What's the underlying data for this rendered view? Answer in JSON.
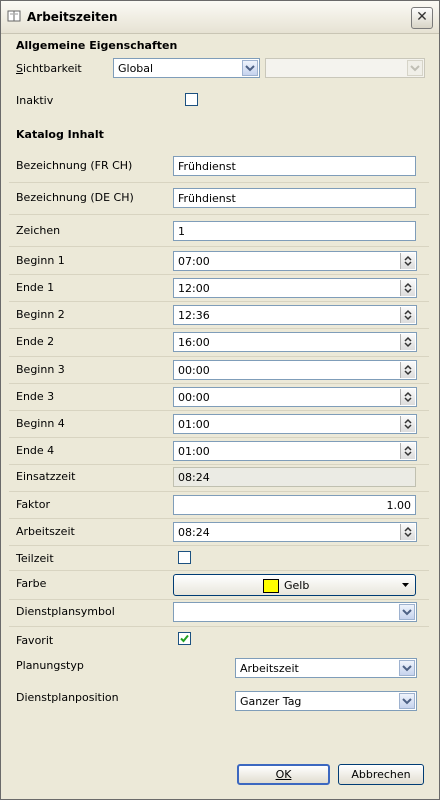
{
  "window": {
    "title": "Arbeitszeiten"
  },
  "general": {
    "heading": "Allgemeine Eigenschaften",
    "sichtbarkeit_label": "Sichtbarkeit",
    "sichtbarkeit_value": "Global",
    "inaktiv_label": "Inaktiv",
    "inaktiv_checked": false
  },
  "catalog": {
    "heading": "Katalog Inhalt",
    "bez_fr_label": "Bezeichnung (FR CH)",
    "bez_fr_value": "Frühdienst",
    "bez_de_label": "Bezeichnung (DE CH)",
    "bez_de_value": "Frühdienst",
    "zeichen_label": "Zeichen",
    "zeichen_value": "1",
    "beginn1_label": "Beginn 1",
    "beginn1_value": "07:00",
    "ende1_label": "Ende 1",
    "ende1_value": "12:00",
    "beginn2_label": "Beginn 2",
    "beginn2_value": "12:36",
    "ende2_label": "Ende 2",
    "ende2_value": "16:00",
    "beginn3_label": "Beginn 3",
    "beginn3_value": "00:00",
    "ende3_label": "Ende 3",
    "ende3_value": "00:00",
    "beginn4_label": "Beginn 4",
    "beginn4_value": "01:00",
    "ende4_label": "Ende 4",
    "ende4_value": "01:00",
    "einsatzzeit_label": "Einsatzzeit",
    "einsatzzeit_value": "08:24",
    "faktor_label": "Faktor",
    "faktor_value": "1.00",
    "arbeitszeit_label": "Arbeitszeit",
    "arbeitszeit_value": "08:24",
    "teilzeit_label": "Teilzeit",
    "teilzeit_checked": false,
    "farbe_label": "Farbe",
    "farbe_value": "Gelb",
    "farbe_color": "#ffff00",
    "dienstplansymbol_label": "Dienstplansymbol",
    "dienstplansymbol_value": "",
    "favorit_label": "Favorit",
    "favorit_checked": true,
    "planungstyp_label": "Planungstyp",
    "planungstyp_value": "Arbeitszeit",
    "dienstplanposition_label": "Dienstplanposition",
    "dienstplanposition_value": "Ganzer Tag"
  },
  "buttons": {
    "ok_label": "OK",
    "abbrechen_label": "Abbrechen"
  }
}
